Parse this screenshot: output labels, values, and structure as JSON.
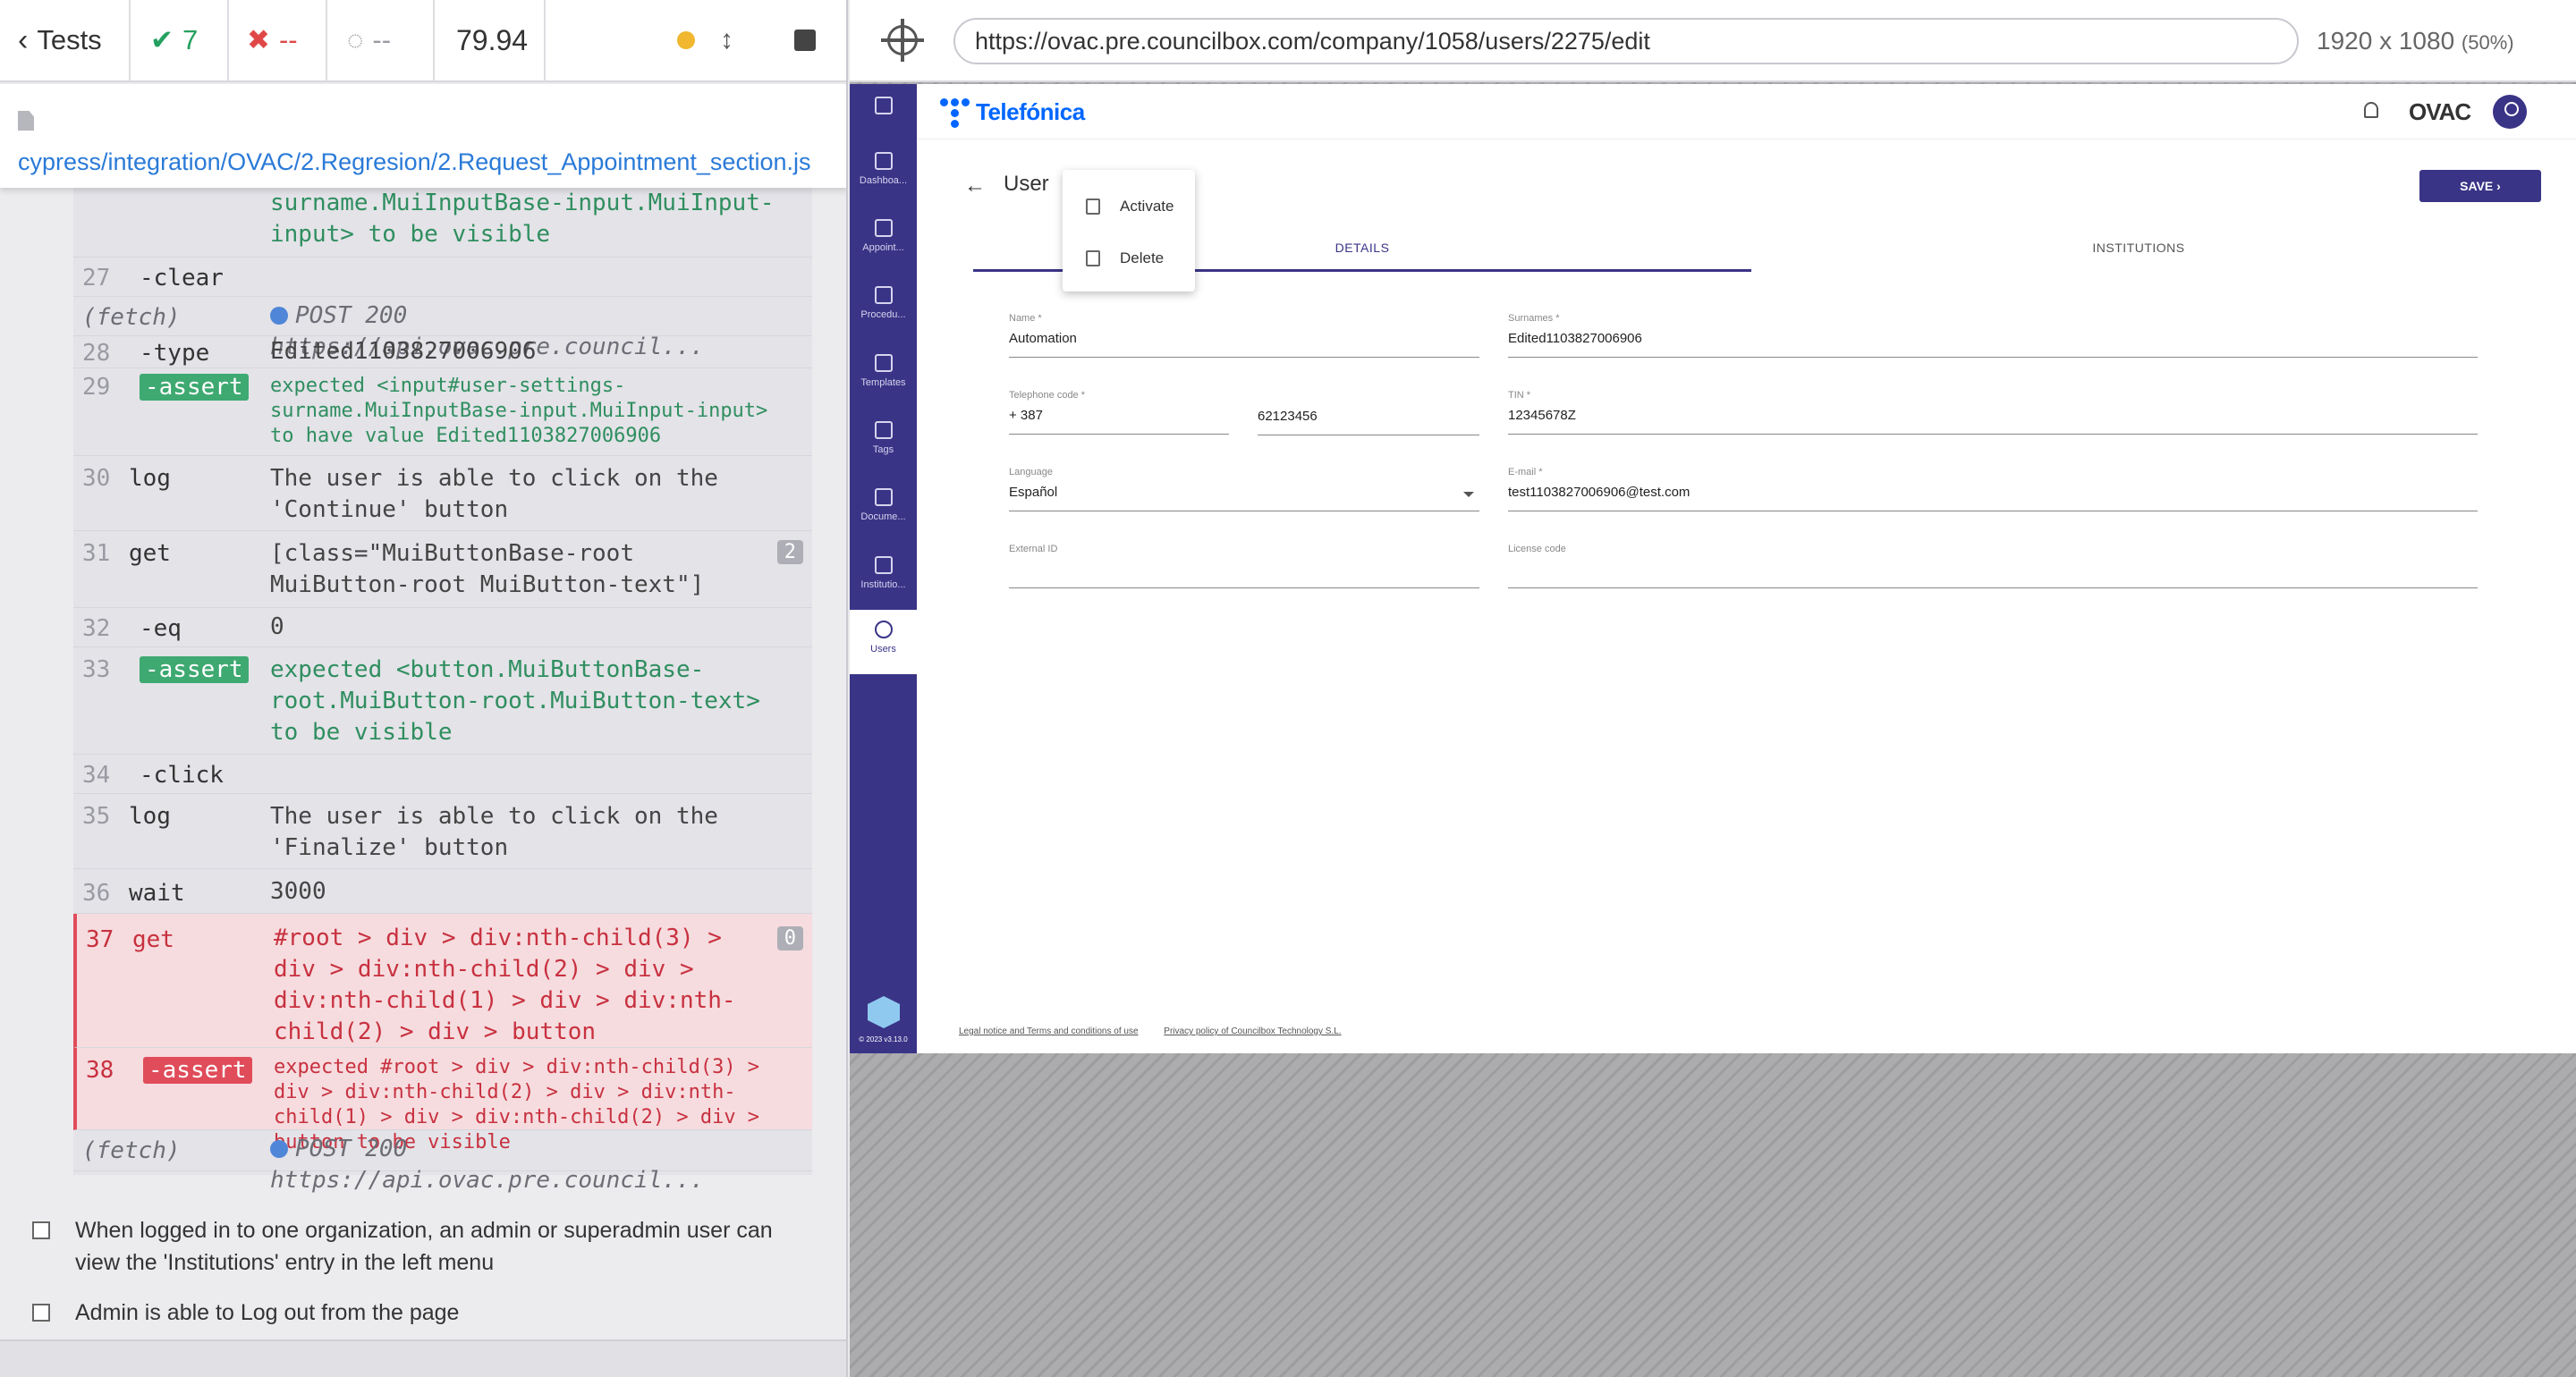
{
  "reporter": {
    "tests_label": "Tests",
    "passed": "7",
    "failed": "--",
    "pending": "--",
    "duration": "79.94",
    "spec_path": "cypress/integration/OVAC/2.Regresion/2.Request_Appointment_section.js"
  },
  "commands": [
    {
      "num": "",
      "name": "",
      "msg": "surname.MuiInputBase-input.MuiInput-input>  to be  visible"
    },
    {
      "num": "27",
      "name": "-clear",
      "msg": ""
    },
    {
      "num": "",
      "name": "(fetch)",
      "msg": "POST 200 https://api.ovac.pre.council..."
    },
    {
      "num": "28",
      "name": "-type",
      "msg": "Edited1103827006906"
    },
    {
      "num": "29",
      "name": "-assert",
      "msg": "expected  <input#user-settings-surname.MuiInputBase-input.MuiInput-input>  to have value  Edited1103827006906"
    },
    {
      "num": "30",
      "name": "log",
      "msg": "The user is able to click on the 'Continue' button"
    },
    {
      "num": "31",
      "name": "get",
      "msg": "[class=\"MuiButtonBase-root MuiButton-root MuiButton-text\"]",
      "count": "2"
    },
    {
      "num": "32",
      "name": "-eq",
      "msg": "0"
    },
    {
      "num": "33",
      "name": "-assert",
      "msg": "expected  <button.MuiButtonBase-root.MuiButton-root.MuiButton-text>  to be  visible"
    },
    {
      "num": "34",
      "name": "-click",
      "msg": ""
    },
    {
      "num": "35",
      "name": "log",
      "msg": "The user is able to click on the 'Finalize' button"
    },
    {
      "num": "36",
      "name": "wait",
      "msg": "3000"
    },
    {
      "num": "37",
      "name": "get",
      "msg": "#root > div > div:nth-child(3) > div > div:nth-child(2) > div > div:nth-child(1) > div > div:nth-child(2) > div > button",
      "count": "0"
    },
    {
      "num": "38",
      "name": "-assert",
      "msg": "expected  #root > div > div:nth-child(3) > div > div:nth-child(2) > div > div:nth-child(1) > div > div:nth-child(2) > div > button  to be  visible"
    },
    {
      "num": "",
      "name": "(fetch)",
      "msg": "POST 200 https://api.ovac.pre.council..."
    }
  ],
  "tests": [
    "When logged in to one organization, an admin or superadmin user can view the 'Institutions' entry in the left menu",
    "Admin is able to Log out from the page"
  ],
  "aut": {
    "url": "https://ovac.pre.councilbox.com/company/1058/users/2275/edit",
    "viewport": "1920 x 1080",
    "scale": "(50%)"
  },
  "app": {
    "brand": "Telefónica",
    "ovac_logo": "OVAC",
    "sidebar": [
      "",
      "Dashboa...",
      "Appoint...",
      "Procedu...",
      "Templates",
      "Tags",
      "Docume...",
      "Institutio...",
      "Users"
    ],
    "version": "© 2023 v3.13.0",
    "page_title": "User",
    "save_label": "SAVE ›",
    "menu": [
      "Activate",
      "Delete"
    ],
    "tabs": [
      "DETAILS",
      "INSTITUTIONS"
    ],
    "fields": {
      "name_label": "Name *",
      "name": "Automation",
      "surnames_label": "Surnames *",
      "surnames": "Edited1103827006906",
      "tel_label": "Telephone code *",
      "tel_code": "+ 387",
      "phone": "62123456",
      "tin_label": "TIN *",
      "tin": "12345678Z",
      "lang_label": "Language",
      "lang": "Español",
      "email_label": "E-mail *",
      "email": "test1103827006906@test.com",
      "ext_label": "External ID",
      "ext": "",
      "license_label": "License code",
      "license": ""
    },
    "footer": [
      "Legal notice and Terms and conditions of use",
      "Privacy policy of Councilbox Technology S.L."
    ]
  },
  "colors": {
    "primary": "#3a3487",
    "pass": "#25a060",
    "fail": "#e04848",
    "brand": "#0066ff"
  }
}
